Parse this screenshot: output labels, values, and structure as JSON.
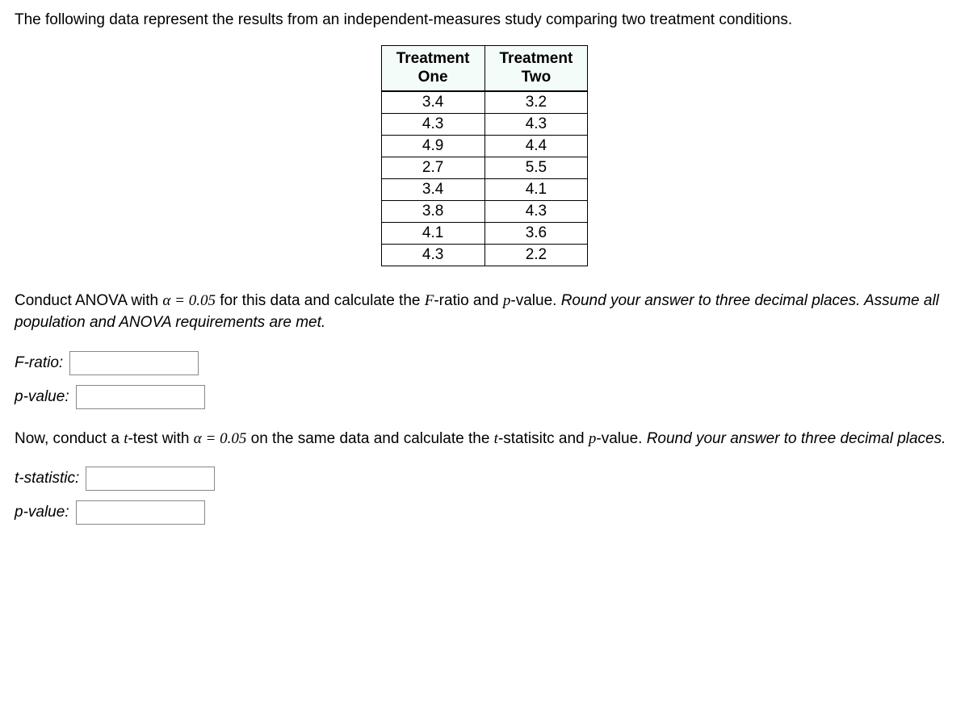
{
  "intro": "The following data represent the results from an independent-measures study comparing two treatment conditions.",
  "table": {
    "headers": {
      "col1_line1": "Treatment",
      "col1_line2": "One",
      "col2_line1": "Treatment",
      "col2_line2": "Two"
    },
    "rows": [
      {
        "c1": "3.4",
        "c2": "3.2"
      },
      {
        "c1": "4.3",
        "c2": "4.3"
      },
      {
        "c1": "4.9",
        "c2": "4.4"
      },
      {
        "c1": "2.7",
        "c2": "5.5"
      },
      {
        "c1": "3.4",
        "c2": "4.1"
      },
      {
        "c1": "3.8",
        "c2": "4.3"
      },
      {
        "c1": "4.1",
        "c2": "3.6"
      },
      {
        "c1": "4.3",
        "c2": "2.2"
      }
    ]
  },
  "anova": {
    "prefix": "Conduct ANOVA with ",
    "alpha_expr": "α = 0.05",
    "mid": " for this data and calculate the ",
    "F": "F",
    "ratio_word": "-ratio and ",
    "p": "p",
    "value_word": "-value. ",
    "italic_tail": "Round your answer to three decimal places. Assume all population and ANOVA requirements are met."
  },
  "labels": {
    "f_ratio": "F-ratio:",
    "p_value": "p-value:",
    "t_stat": "t-statistic:",
    "p_value2": "p-value:"
  },
  "ttest": {
    "prefix": "Now, conduct a ",
    "t": "t",
    "test_with": "-test with ",
    "alpha_expr": "α = 0.05",
    "mid": " on the same data and calculate the ",
    "t2": "t",
    "stat_word": "-statisitc and ",
    "p": "p",
    "value_word": "-value. ",
    "italic_tail": "Round your answer to three decimal places."
  },
  "chart_data": {
    "type": "table",
    "columns": [
      "Treatment One",
      "Treatment Two"
    ],
    "data": [
      [
        3.4,
        3.2
      ],
      [
        4.3,
        4.3
      ],
      [
        4.9,
        4.4
      ],
      [
        2.7,
        5.5
      ],
      [
        3.4,
        4.1
      ],
      [
        3.8,
        4.3
      ],
      [
        4.1,
        3.6
      ],
      [
        4.3,
        2.2
      ]
    ]
  }
}
